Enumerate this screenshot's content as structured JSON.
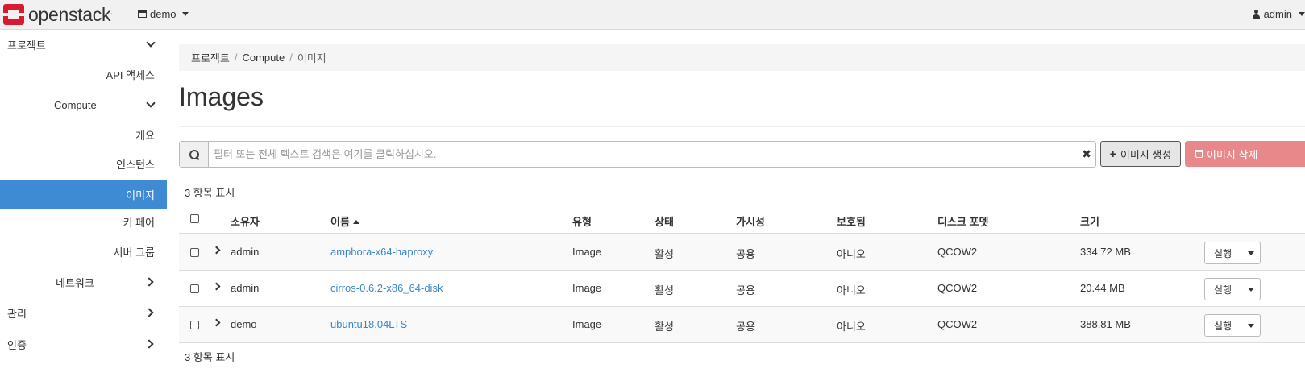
{
  "header": {
    "brand": "openstack",
    "brand_mark": ".",
    "project": "demo",
    "user": "admin"
  },
  "sidebar": {
    "items": [
      {
        "label": "프로젝트",
        "level": 0,
        "chevron": "down"
      },
      {
        "label": "API 액세스",
        "level": 2
      },
      {
        "label": "Compute",
        "level": 1,
        "chevron": "down"
      },
      {
        "label": "개요",
        "level": 2
      },
      {
        "label": "인스턴스",
        "level": 2
      },
      {
        "label": "이미지",
        "level": 2,
        "active": true
      },
      {
        "label": "키 페어",
        "level": 2
      },
      {
        "label": "서버 그룹",
        "level": 2
      },
      {
        "label": "네트워크",
        "level": 1,
        "chevron": "right"
      },
      {
        "label": "관리",
        "level": 0,
        "chevron": "right"
      },
      {
        "label": "인증",
        "level": 0,
        "chevron": "right"
      }
    ]
  },
  "breadcrumb": {
    "items": [
      "프로젝트",
      "Compute",
      "이미지"
    ],
    "separator": "/"
  },
  "page": {
    "title": "Images"
  },
  "search": {
    "placeholder": "필터 또는 전체 텍스트 검색은 여기를 클릭하십시오.",
    "value": "",
    "clear": "✖"
  },
  "actions": {
    "create_label": "이미지 생성",
    "create_icon": "+",
    "delete_label": "이미지 삭제"
  },
  "table": {
    "count_label": "3 항목 표시",
    "columns": [
      "소유자",
      "이름",
      "유형",
      "상태",
      "가시성",
      "보호됨",
      "디스크 포멧",
      "크기"
    ],
    "sorted_column": "이름",
    "rows": [
      {
        "owner": "admin",
        "name": "amphora-x64-haproxy",
        "type": "Image",
        "status": "활성",
        "visibility": "공용",
        "protected": "아니오",
        "format": "QCOW2",
        "size": "334.72 MB",
        "action": "실행"
      },
      {
        "owner": "admin",
        "name": "cirros-0.6.2-x86_64-disk",
        "type": "Image",
        "status": "활성",
        "visibility": "공용",
        "protected": "아니오",
        "format": "QCOW2",
        "size": "20.44 MB",
        "action": "실행"
      },
      {
        "owner": "demo",
        "name": "ubuntu18.04LTS",
        "type": "Image",
        "status": "활성",
        "visibility": "공용",
        "protected": "아니오",
        "format": "QCOW2",
        "size": "388.81 MB",
        "action": "실행"
      }
    ]
  },
  "colors": {
    "accent": "#3f8bd3",
    "link": "#3a87c8",
    "danger": "#e8888a",
    "brand_red": "#da1a32"
  }
}
